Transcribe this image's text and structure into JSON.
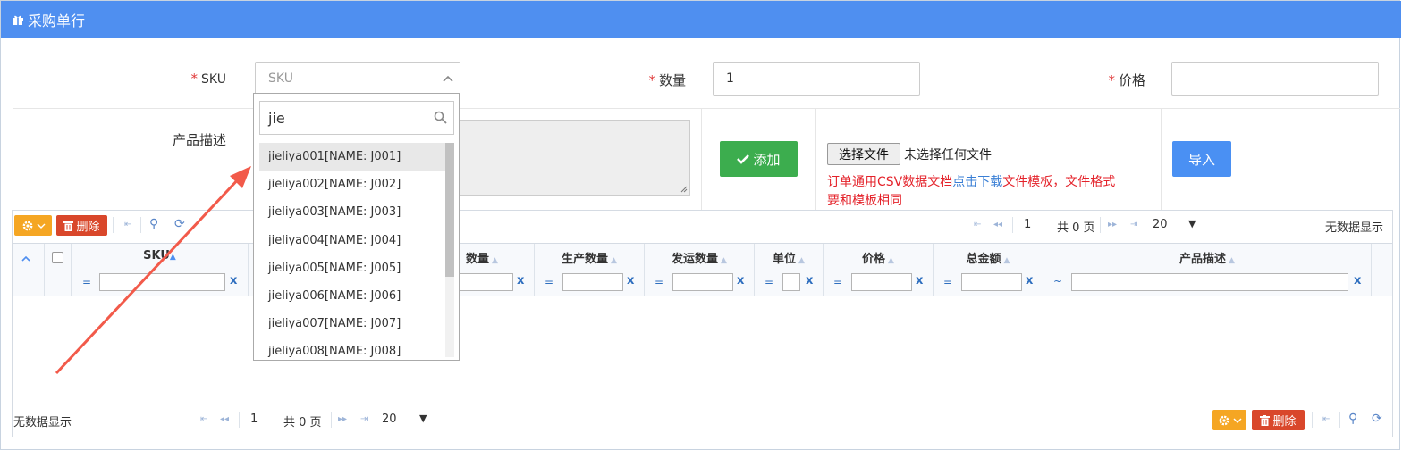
{
  "header": {
    "title": "采购单行"
  },
  "form": {
    "sku_label": "SKU",
    "sku_placeholder": "SKU",
    "qty_label": "数量",
    "qty_value": "1",
    "price_label": "价格",
    "price_value": "",
    "desc_label": "产品描述",
    "add_button": "添加",
    "file_button": "选择文件",
    "file_status": "未选择任何文件",
    "notice_part1": "订单通用CSV数据文档",
    "notice_link": "点击下载",
    "notice_part2": "文件模板，文件格式",
    "notice_line2": "要和模板相同",
    "import_button": "导入",
    "required_mark": "*"
  },
  "dropdown": {
    "search_value": "jie",
    "items": [
      "jieliya001[NAME: J001]",
      "jieliya002[NAME: J002]",
      "jieliya003[NAME: J003]",
      "jieliya004[NAME: J004]",
      "jieliya005[NAME: J005]",
      "jieliya006[NAME: J006]",
      "jieliya007[NAME: J007]",
      "jieliya008[NAME: J008]"
    ]
  },
  "grid": {
    "delete_label": "删除",
    "page_value": "1",
    "page_total": "共 0 页",
    "page_size": "20",
    "no_data": "无数据显示",
    "columns": {
      "sku": "SKU",
      "qty": "数量",
      "prod_qty": "生产数量",
      "ship_qty": "发运数量",
      "unit": "单位",
      "price": "价格",
      "total": "总金额",
      "desc": "产品描述"
    },
    "filter_eq": "=",
    "filter_tilde": "~",
    "filter_x": "x"
  }
}
